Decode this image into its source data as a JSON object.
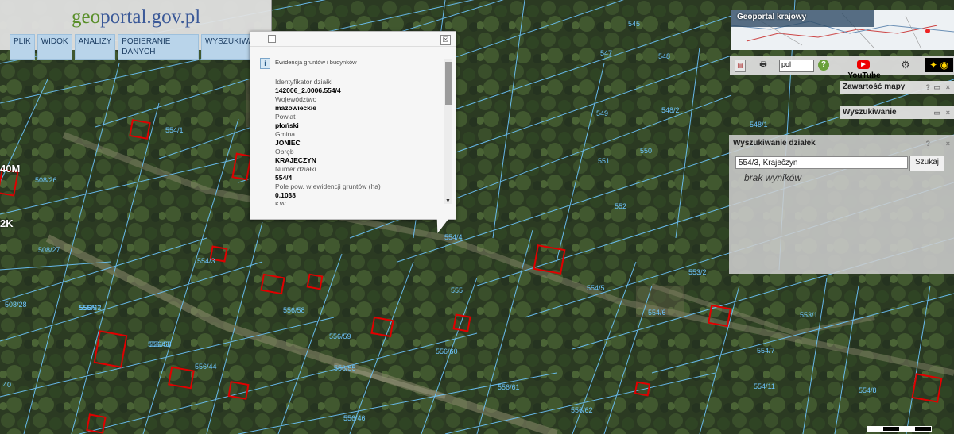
{
  "header": {
    "logo_prefix": "geo",
    "logo_suffix": "portal.gov.pl",
    "menu": [
      "PLIK",
      "WIDOK",
      "ANALIZY",
      "POBIERANIE DANYCH",
      "WYSZUKIWANIA"
    ]
  },
  "popup": {
    "title": "Ewidencja gruntów i budynków",
    "close_glyph": "☒",
    "info_glyph": "i",
    "rows": [
      {
        "label": "Identyfikator działki",
        "value": "142006_2.0006.554/4"
      },
      {
        "label": "Województwo",
        "value": "mazowieckie"
      },
      {
        "label": "Powiat",
        "value": "płoński"
      },
      {
        "label": "Gmina",
        "value": "JONIEC"
      },
      {
        "label": "Obręb",
        "value": "KRAJĘCZYN"
      },
      {
        "label": "Numer działki",
        "value": "554/4"
      },
      {
        "label": "Pole pow. w ewidencji gruntów (ha)",
        "value": "0.1038"
      },
      {
        "label": "KW",
        "value": ""
      }
    ]
  },
  "overview": {
    "title": "Geoportal krajowy"
  },
  "toolbar": {
    "language": "pol",
    "youtube_label": "YouTube"
  },
  "panels": {
    "map_contents": "Zawartość mapy",
    "search": "Wyszukiwanie",
    "controls": [
      "?",
      "▭",
      "×"
    ]
  },
  "parcel_search": {
    "title": "Wyszukiwanie działek",
    "query": "554/3, Kraječzyn",
    "button": "Szukaj",
    "result": "brak wyników",
    "controls": [
      "?",
      "–",
      "×"
    ]
  },
  "map": {
    "plot_labels": [
      "545",
      "547",
      "548",
      "549",
      "548/2",
      "548/1",
      "550",
      "551",
      "552",
      "553/2",
      "553/1",
      "554/1",
      "554/3",
      "554/4",
      "554/5",
      "554/6",
      "554/7",
      "554/11",
      "554/8",
      "555",
      "556/60",
      "556/59",
      "556/58",
      "556/57",
      "556/58",
      "556/55",
      "556/44",
      "556/43",
      "556/42",
      "556/46",
      "556/61",
      "556/62",
      "508/26",
      "508/27",
      "508/28",
      "40"
    ],
    "building_labels": [
      "40M",
      "2K"
    ],
    "icons": {
      "legend": "legend-icon",
      "print": "print-icon",
      "help": "help-icon",
      "youtube": "youtube-icon",
      "settings": "settings-icon",
      "eye": "eye-icon"
    },
    "colors": {
      "parcel_line": "#6ec6ff",
      "building": "#e00000"
    }
  }
}
